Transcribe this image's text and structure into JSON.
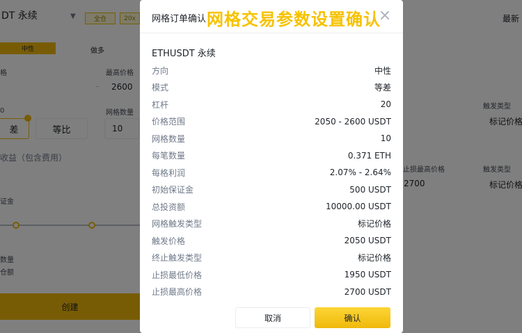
{
  "background": {
    "symbol_title": "DT 永续",
    "pill_1": "全仓",
    "pill_2": "20x",
    "right_top": "最新",
    "tab_neutral": "中性",
    "tab_long": "做多",
    "label_price_suffix": "格",
    "label_max_price": "最高价格",
    "max_price_value": "2600",
    "label_grid_count": "网格数量",
    "grid_count_value": "10",
    "mode_arith": "差",
    "mode_geom": "等比",
    "profit_label": "收益（包含费用）",
    "margin_label": "证金",
    "qty_label": "数量",
    "other_label": "仓额",
    "create_button": "创建",
    "trigger_type_1": "触发类型",
    "trigger_value_1": "标记价格",
    "stop_max_label": "止损最高价格",
    "stop_max_value": "2700",
    "trigger_type_2": "触发类型",
    "trigger_value_2": "标记价格",
    "leftmost_char": "0"
  },
  "modal": {
    "title": "网格订单确认",
    "banner": "网格交易参数设置确认",
    "symbol": "ETHUSDT 永续",
    "rows": [
      {
        "k": "方向",
        "v": "中性"
      },
      {
        "k": "模式",
        "v": "等差"
      },
      {
        "k": "杠杆",
        "v": "20"
      },
      {
        "k": "价格范围",
        "v": "2050 - 2600 USDT"
      },
      {
        "k": "网格数量",
        "v": "10"
      },
      {
        "k": "每笔数量",
        "v": "0.371 ETH"
      },
      {
        "k": "每格利润",
        "v": "2.07% - 2.64%"
      },
      {
        "k": "初始保证金",
        "v": "500 USDT"
      },
      {
        "k": "总投资额",
        "v": "10000.00 USDT"
      },
      {
        "k": "网格触发类型",
        "v": "标记价格"
      },
      {
        "k": "触发价格",
        "v": "2050 USDT"
      },
      {
        "k": "终止触发类型",
        "v": "标记价格"
      },
      {
        "k": "止损最低价格",
        "v": "1950 USDT"
      },
      {
        "k": "止损最高价格",
        "v": "2700 USDT"
      }
    ],
    "cancel_label": "取消",
    "confirm_label": "确认"
  }
}
